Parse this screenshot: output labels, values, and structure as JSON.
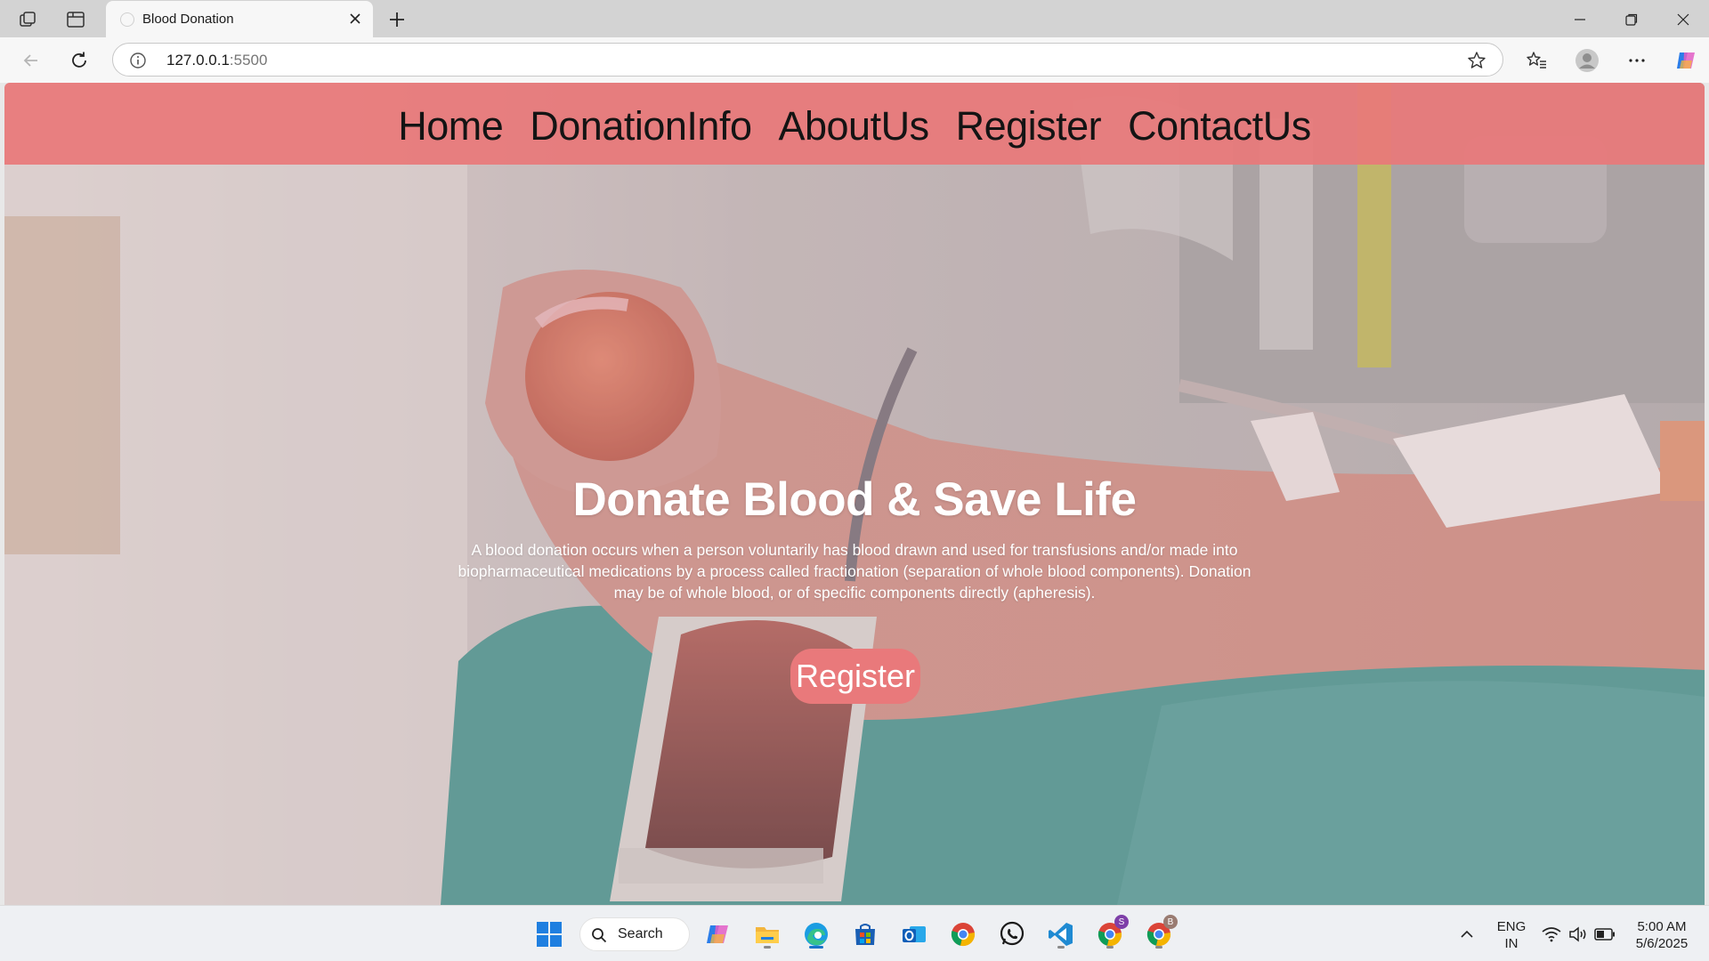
{
  "browser": {
    "tab_title": "Blood Donation",
    "url_host": "127.0.0.1",
    "url_port": ":5500"
  },
  "site": {
    "nav": [
      "Home",
      "DonationInfo",
      "AboutUs",
      "Register",
      "ContactUs"
    ],
    "hero_title": "Donate Blood & Save Life",
    "hero_description": "A blood donation occurs when a person voluntarily has blood drawn and used for transfusions and/or made into biopharmaceutical medications by a process called fractionation (separation of whole blood components). Donation may be of whole blood, or of specific components directly (apheresis).",
    "hero_button": "Register",
    "colors": {
      "nav_bg": "#e8787a",
      "button_bg": "#e9797b",
      "hero_text": "#ffffff"
    }
  },
  "taskbar": {
    "search_label": "Search",
    "language": "ENG",
    "region": "IN",
    "time": "5:00 AM",
    "date": "5/6/2025",
    "apps": [
      "windows-start-icon",
      "copilot-icon",
      "file-explorer-icon",
      "edge-icon",
      "microsoft-store-icon",
      "outlook-icon",
      "chrome-icon",
      "whatsapp-icon",
      "vscode-icon",
      "chrome-profile-s-icon",
      "chrome-profile-b-icon"
    ],
    "chrome_profile_s_badge": "S",
    "chrome_profile_b_badge": "B"
  }
}
